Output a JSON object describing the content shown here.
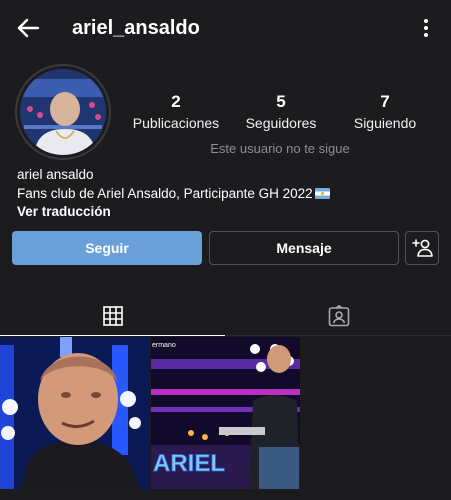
{
  "header": {
    "username": "ariel_ansaldo",
    "back_icon": "arrow-left-icon",
    "more_icon": "vertical-dots-icon"
  },
  "stats": {
    "posts": {
      "value": "2",
      "label": "Publicaciones"
    },
    "followers": {
      "value": "5",
      "label": "Seguidores"
    },
    "following": {
      "value": "7",
      "label": "Siguiendo"
    }
  },
  "follow_status": "Este usuario no te sigue",
  "bio": {
    "name": "ariel ansaldo",
    "description": "Fans club de Ariel Ansaldo, Participante GH 2022",
    "translate": "Ver traducción"
  },
  "buttons": {
    "follow": "Seguir",
    "message": "Mensaje"
  },
  "tabs": [
    "grid-icon",
    "tagged-icon"
  ],
  "posts": [
    {
      "overlay_text": ""
    },
    {
      "overlay_text": "ARIEL",
      "corner_text": "ermano"
    }
  ],
  "colors": {
    "background": "#1c1c1e",
    "follow_button": "#6a9fd8",
    "secondary_text": "#8e8e93"
  }
}
